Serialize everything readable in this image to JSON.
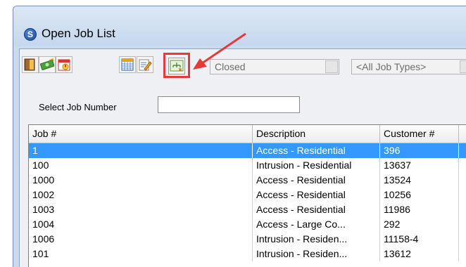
{
  "window": {
    "title": "Open Job List",
    "app_icon_letter": "S"
  },
  "toolbar": {
    "buttons": [
      {
        "icon": "open-door-icon"
      },
      {
        "icon": "money-icon"
      },
      {
        "icon": "calendar-alert-icon"
      },
      {
        "icon": "calendar-grid-icon"
      },
      {
        "icon": "edit-note-icon"
      },
      {
        "icon": "tree-chart-icon"
      }
    ],
    "status_combo": "Closed",
    "type_combo": "<All Job Types>"
  },
  "filter": {
    "label": "Select Job Number",
    "value": ""
  },
  "grid": {
    "columns": [
      "Job #",
      "Description",
      "Customer #"
    ],
    "rows": [
      [
        "1",
        "Access - Residential",
        "396"
      ],
      [
        "100",
        "Intrusion - Residential",
        "13637"
      ],
      [
        "1000",
        "Access - Residential",
        "13524"
      ],
      [
        "1002",
        "Access - Residential",
        "10256"
      ],
      [
        "1003",
        "Access - Residential",
        "11986"
      ],
      [
        "1004",
        "Access - Large Co...",
        "292"
      ],
      [
        "1006",
        "Intrusion - Residen...",
        "11158-4"
      ],
      [
        "101",
        "Intrusion - Residen...",
        "13612"
      ]
    ],
    "selected_row": 0
  },
  "colors": {
    "highlight": "#e63a3a",
    "selection": "#3399ff"
  }
}
